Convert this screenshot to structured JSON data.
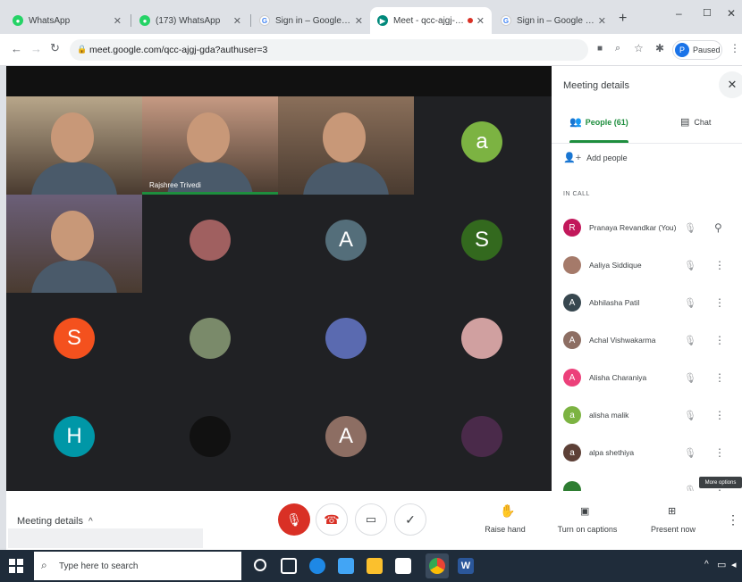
{
  "browser": {
    "tabs": [
      {
        "label": "WhatsApp",
        "icon": "whatsapp-icon",
        "color": "#25d366"
      },
      {
        "label": "(173) WhatsApp",
        "icon": "whatsapp-icon",
        "color": "#25d366"
      },
      {
        "label": "Sign in – Google accounts",
        "icon": "google-icon",
        "color": "#4285f4"
      },
      {
        "label": "Meet - qcc-ajgj-gda",
        "icon": "meet-icon",
        "color": "#00897b"
      },
      {
        "label": "Sign in – Google accounts",
        "icon": "google-icon",
        "color": "#4285f4"
      }
    ],
    "new_tab": "+",
    "url": "meet.google.com/qcc-ajgj-gda?authuser=3",
    "profile_status": "Paused",
    "profile_initial": "P",
    "window_controls": {
      "minimize": "–",
      "maximize": "☐",
      "close": "✕"
    }
  },
  "meeting": {
    "tiles": [
      {
        "kind": "video",
        "name": "",
        "bg": "#b8a68a"
      },
      {
        "kind": "video",
        "name": "Rajshree Trivedi",
        "bg": "#c69a83"
      },
      {
        "kind": "video",
        "name": "",
        "bg": "#8a6f5a"
      },
      {
        "kind": "avatar",
        "letter": "a",
        "color": "#7cb342"
      },
      {
        "kind": "video",
        "name": "",
        "bg": "#6b5f78"
      },
      {
        "kind": "photo",
        "letter": "",
        "color": "#a06060"
      },
      {
        "kind": "avatar",
        "letter": "A",
        "color": "#546e7a"
      },
      {
        "kind": "avatar",
        "letter": "S",
        "color": "#33691e"
      },
      {
        "kind": "avatar",
        "letter": "S",
        "color": "#f4511e"
      },
      {
        "kind": "photo",
        "letter": "",
        "color": "#7a8a6a"
      },
      {
        "kind": "photo",
        "letter": "",
        "color": "#5a6ab0"
      },
      {
        "kind": "photo",
        "letter": "",
        "color": "#d0a0a0"
      },
      {
        "kind": "avatar",
        "letter": "H",
        "color": "#0097a7"
      },
      {
        "kind": "photo",
        "letter": "",
        "color": "#111111"
      },
      {
        "kind": "avatar",
        "letter": "A",
        "color": "#8d6e63"
      },
      {
        "kind": "photo",
        "letter": "",
        "color": "#4a2a4a"
      }
    ]
  },
  "panel": {
    "title": "Meeting details",
    "close": "✕",
    "tab_people": "People (61)",
    "tab_chat": "Chat",
    "add_people": "Add people",
    "in_call": "IN CALL",
    "people": [
      {
        "initial": "R",
        "name": "Pranaya Revandkar (You)",
        "color": "#c2185b"
      },
      {
        "initial": "",
        "name": "Aaliya Siddique",
        "color": "#a57a6a"
      },
      {
        "initial": "A",
        "name": "Abhilasha Patil",
        "color": "#37474f"
      },
      {
        "initial": "A",
        "name": "Achal Vishwakarma",
        "color": "#8d6e63"
      },
      {
        "initial": "A",
        "name": "Alisha Charaniya",
        "color": "#ec407a"
      },
      {
        "initial": "a",
        "name": "alisha malik",
        "color": "#7cb342"
      },
      {
        "initial": "a",
        "name": "alpa shethiya",
        "color": "#5d4037"
      },
      {
        "initial": "",
        "name": "",
        "color": "#2e7d32"
      }
    ],
    "tooltip": "More options"
  },
  "controls": {
    "meeting_details": "Meeting details",
    "raise_hand": "Raise hand",
    "captions": "Turn on captions",
    "present": "Present now"
  },
  "taskbar": {
    "search_placeholder": "Type here to search"
  }
}
